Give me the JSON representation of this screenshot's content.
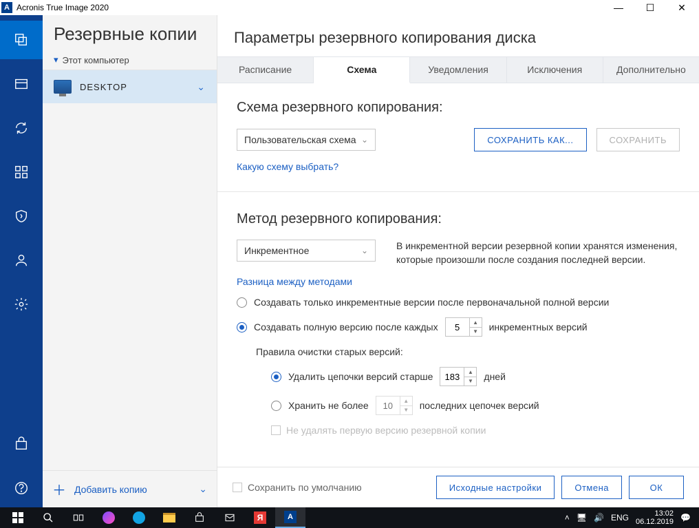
{
  "titlebar": {
    "app_name": "Acronis True Image 2020",
    "logo_letter": "A"
  },
  "sidebar": {
    "header": "Резервные копии",
    "sub": "Этот компьютер",
    "item_label": "DESKTOP",
    "add_label": "Добавить копию"
  },
  "main": {
    "title": "Параметры резервного копирования диска",
    "tabs": [
      "Расписание",
      "Схема",
      "Уведомления",
      "Исключения",
      "Дополнительно"
    ],
    "scheme": {
      "title": "Схема резервного копирования:",
      "select_value": "Пользовательская схема",
      "save_as": "СОХРАНИТЬ КАК...",
      "save": "СОХРАНИТЬ",
      "help_link": "Какую схему выбрать?"
    },
    "method": {
      "title": "Метод резервного копирования:",
      "select_value": "Инкрементное",
      "description": "В инкрементной версии резервной копии хранятся изменения, которые произошли после создания последней версии.",
      "diff_link": "Разница между методами",
      "radio1": "Создавать только инкрементные версии после первоначальной полной версии",
      "radio2_pre": "Создавать полную версию после каждых",
      "radio2_value": "5",
      "radio2_post": "инкрементных версий",
      "cleanup_title": "Правила очистки старых версий:",
      "clean_r1_pre": "Удалить цепочки версий старше",
      "clean_r1_value": "183",
      "clean_r1_post": "дней",
      "clean_r2_pre": "Хранить не более",
      "clean_r2_value": "10",
      "clean_r2_post": "последних цепочек версий",
      "no_delete_first": "Не удалять первую версию резервной копии"
    },
    "footer": {
      "save_default": "Сохранить по умолчанию",
      "defaults": "Исходные настройки",
      "cancel": "Отмена",
      "ok": "ОК"
    }
  },
  "taskbar": {
    "lang": "ENG",
    "time": "13:02",
    "date": "06.12.2019"
  }
}
